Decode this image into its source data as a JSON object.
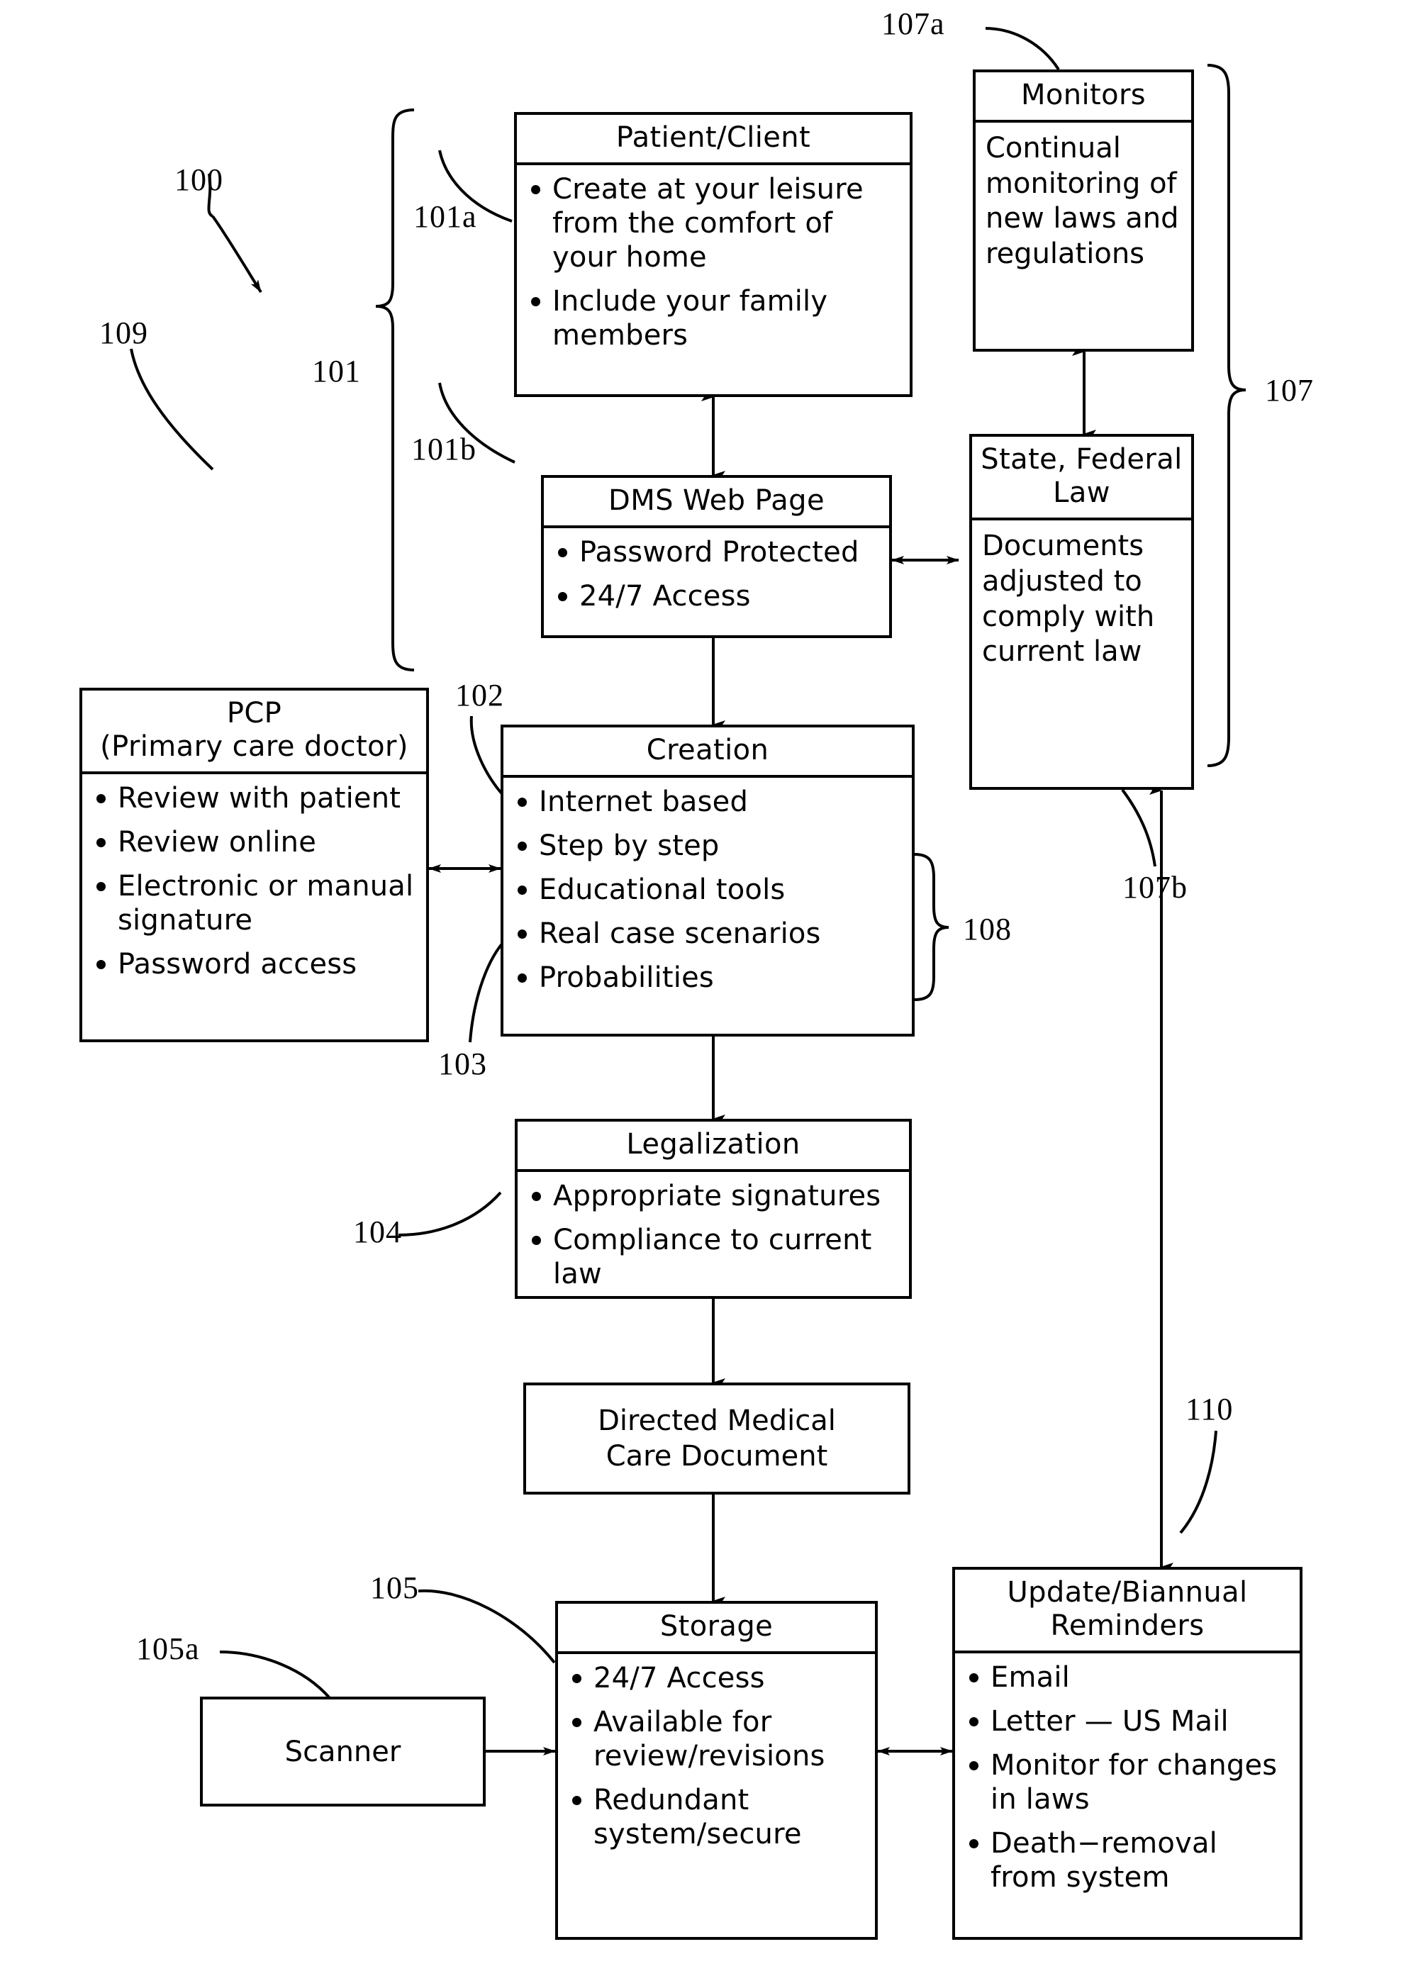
{
  "figure": {
    "title": "Directed Medical Care Document System Flow Diagram",
    "reference_numerals": [
      {
        "id": "100",
        "label": "100"
      },
      {
        "id": "101",
        "label": "101"
      },
      {
        "id": "101a",
        "label": "101a"
      },
      {
        "id": "101b",
        "label": "101b"
      },
      {
        "id": "102",
        "label": "102"
      },
      {
        "id": "103",
        "label": "103"
      },
      {
        "id": "104",
        "label": "104"
      },
      {
        "id": "105",
        "label": "105"
      },
      {
        "id": "105a",
        "label": "105a"
      },
      {
        "id": "107",
        "label": "107"
      },
      {
        "id": "107a",
        "label": "107a"
      },
      {
        "id": "107b",
        "label": "107b"
      },
      {
        "id": "108",
        "label": "108"
      },
      {
        "id": "109",
        "label": "109"
      },
      {
        "id": "110",
        "label": "110"
      }
    ],
    "boxes": {
      "patient_client": {
        "title": "Patient/Client",
        "bullets": [
          "Create at your leisure from the comfort of your home",
          "Include your family members"
        ]
      },
      "monitors": {
        "title": "Monitors",
        "text": "Continual monitoring of new laws and regulations"
      },
      "dms_web_page": {
        "title": "DMS Web Page",
        "bullets": [
          "Password Protected",
          "24/7 Access"
        ]
      },
      "state_federal_law": {
        "title": "State, Federal Law",
        "text": "Documents adjusted to comply with current law"
      },
      "pcp": {
        "title": "PCP (Primary care doctor)",
        "title_line1": "PCP",
        "title_line2": "(Primary care doctor)",
        "bullets": [
          "Review with patient",
          "Review online",
          "Electronic or manual signature",
          "Password access"
        ]
      },
      "creation": {
        "title": "Creation",
        "bullets": [
          "Internet based",
          "Step by step",
          "Educational tools",
          "Real case scenarios",
          "Probabilities"
        ]
      },
      "legalization": {
        "title": "Legalization",
        "bullets": [
          "Appropriate signatures",
          "Compliance to current law"
        ]
      },
      "directed_medical_care_document": {
        "title_line1": "Directed Medical",
        "title_line2": "Care Document"
      },
      "storage": {
        "title": "Storage",
        "bullets": [
          "24/7 Access",
          "Available for review/revisions",
          "Redundant system/secure"
        ]
      },
      "scanner": {
        "title": "Scanner"
      },
      "update_reminders": {
        "title_line1": "Update/Biannual",
        "title_line2": "Reminders",
        "bullets": [
          "Email",
          "Letter — US Mail",
          "Monitor for changes in laws",
          "Death−removal from system"
        ]
      }
    },
    "colors": {
      "line": "#000000",
      "background": "#ffffff",
      "text": "#000000"
    }
  }
}
